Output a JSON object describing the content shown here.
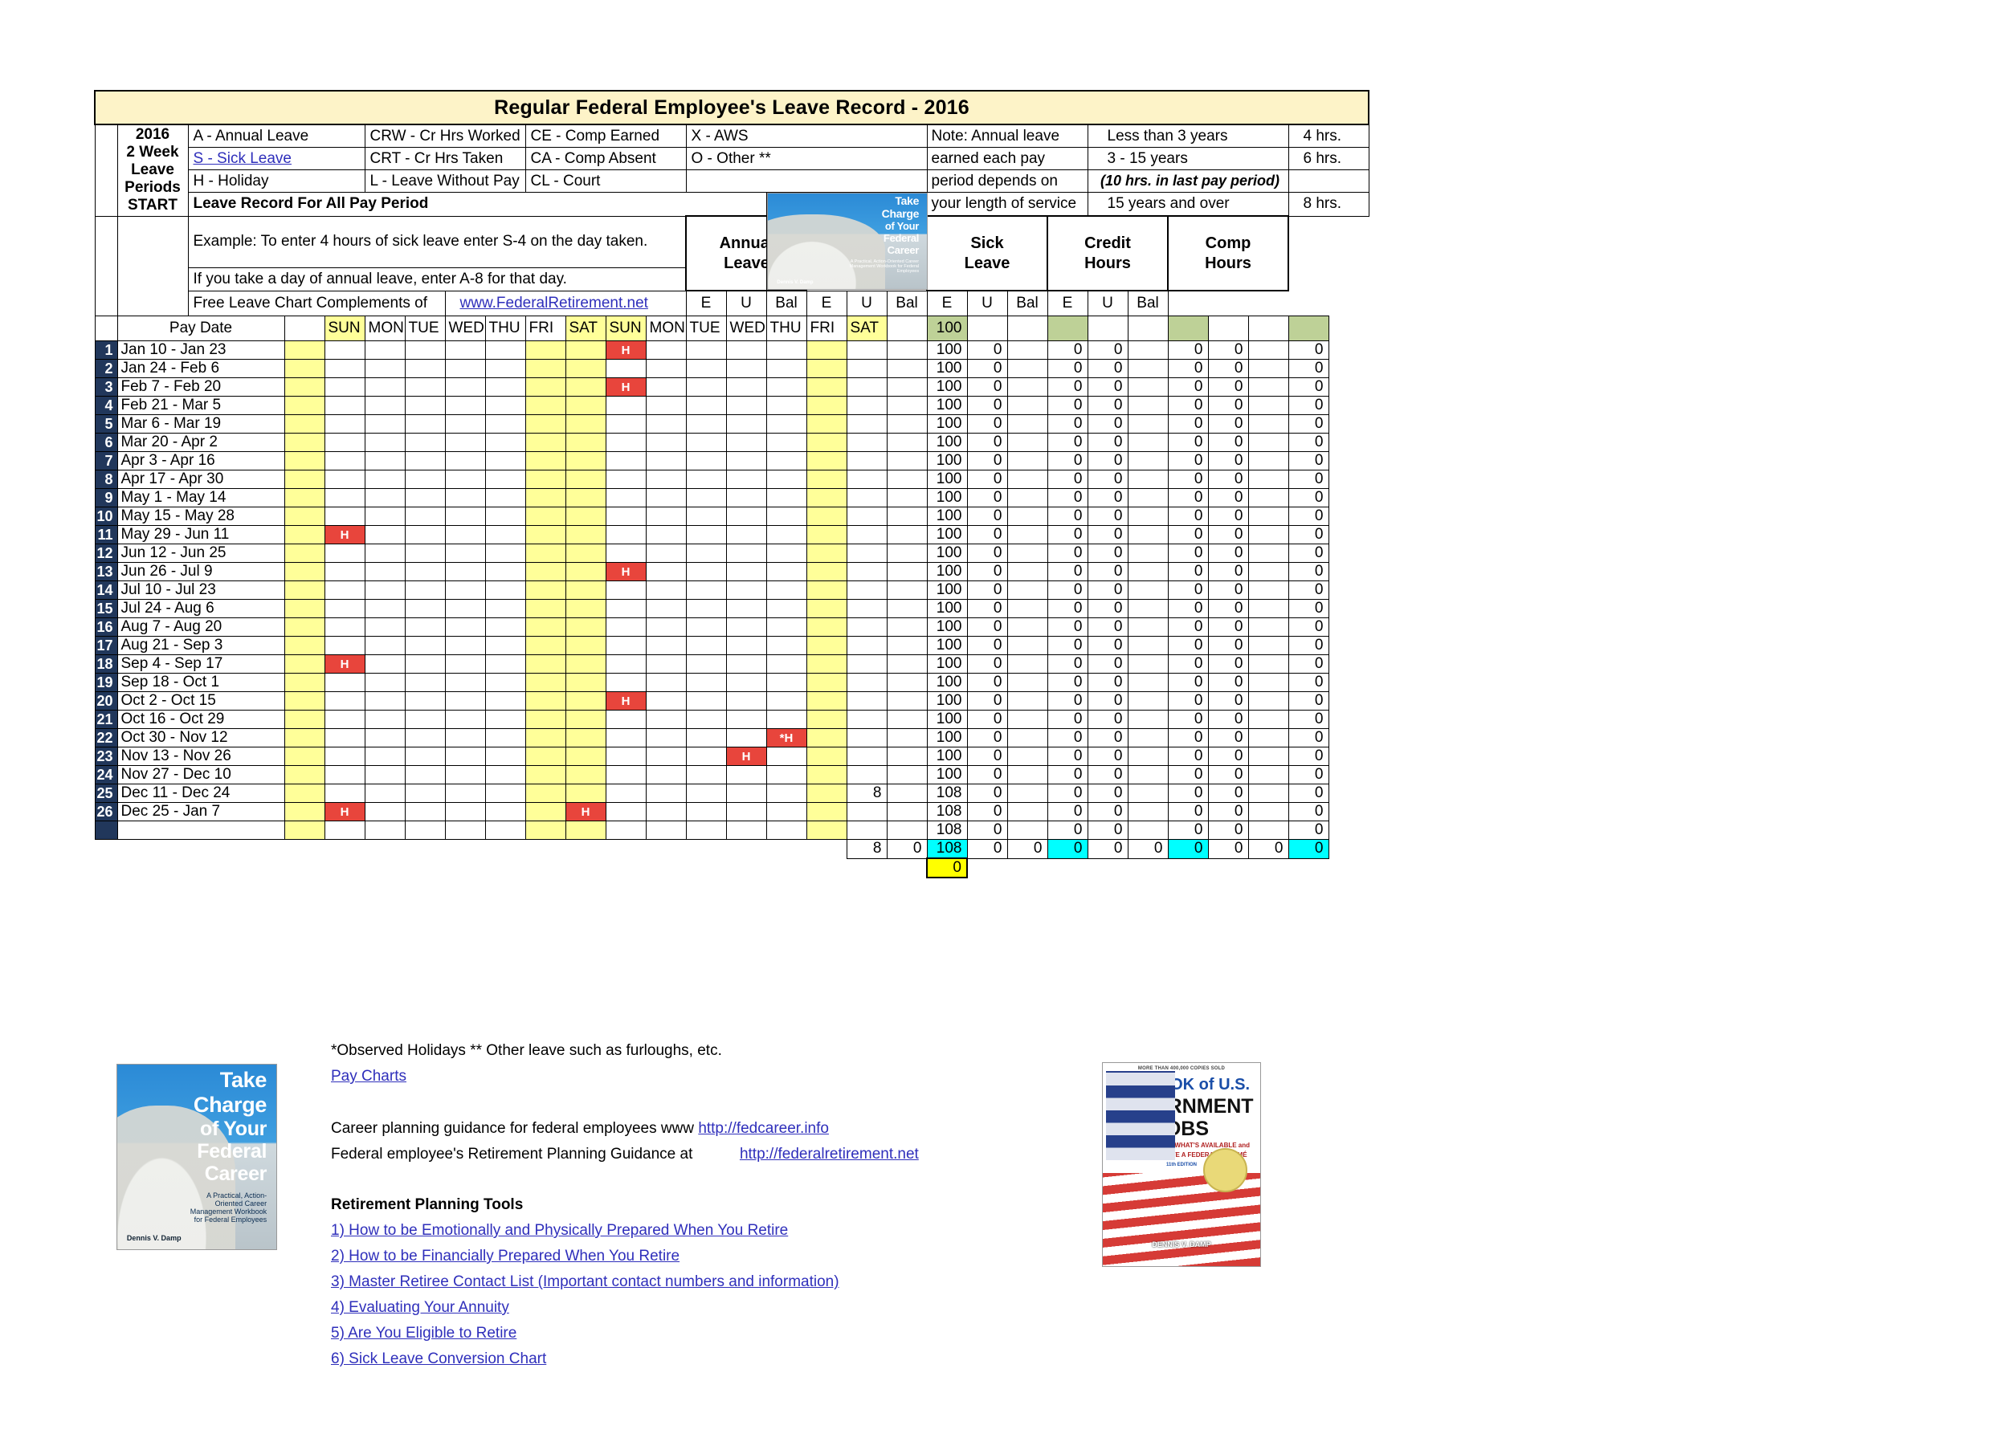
{
  "title": "Regular Federal Employee's Leave Record - 2016",
  "legend": {
    "col1": [
      "A - Annual Leave",
      "S  - Sick Leave",
      "H - Holiday"
    ],
    "col2": [
      "CRW - Cr Hrs Worked",
      "CRT - Cr Hrs Taken",
      "L    - Leave Without Pay"
    ],
    "col3": [
      "CE - Comp Earned",
      "CA - Comp Absent",
      "CL  - Court"
    ],
    "col4": [
      "X - AWS",
      "O - Other **",
      ""
    ],
    "record_header": "Leave Record For All Pay Period",
    "example1": "Example: To enter 4 hours of sick leave enter S-4 on the day taken.",
    "example2": "If you take a day of annual leave, enter A-8 for that day.",
    "complements_label": "Free Leave Chart Complements of",
    "complements_link": "www.FederalRetirement.net"
  },
  "left_labels": [
    "2016",
    "2 Week",
    "Leave Periods",
    "START"
  ],
  "note": {
    "lines": [
      "Note:  Annual leave",
      "earned each pay",
      "period depends on",
      "your length of service"
    ],
    "service": [
      "Less than 3 years",
      "3 - 15 years",
      "(10 hrs. in last pay period)",
      "15 years and over"
    ],
    "hours": [
      "4 hrs.",
      "6 hrs.",
      "",
      "8 hrs."
    ]
  },
  "categories": [
    {
      "l1": "Annual",
      "l2": "Leave"
    },
    {
      "l1": "Sick",
      "l2": "Leave"
    },
    {
      "l1": "Credit",
      "l2": "Hours"
    },
    {
      "l1": "Comp",
      "l2": "Hours"
    }
  ],
  "sub_headers": [
    "E",
    "U",
    "Bal"
  ],
  "pay_date_header": "Pay Date",
  "day_headers": [
    "SUN",
    "MON",
    "TUE",
    "WED",
    "THU",
    "FRI",
    "SAT",
    "SUN",
    "MON",
    "TUE",
    "WED",
    "THU",
    "FRI",
    "SAT"
  ],
  "starting_balance": "100",
  "rows": [
    {
      "n": "1",
      "date": "Jan 10 - Jan 23",
      "holidays": {
        "8": "H"
      },
      "annual": [
        "",
        "",
        "100"
      ],
      "sick": [
        "0",
        "",
        "0"
      ],
      "credit": [
        "0",
        "",
        "0"
      ],
      "comp": [
        "0",
        "",
        "0"
      ]
    },
    {
      "n": "2",
      "date": "Jan 24 - Feb 6",
      "holidays": {},
      "annual": [
        "",
        "",
        "100"
      ],
      "sick": [
        "0",
        "",
        "0"
      ],
      "credit": [
        "0",
        "",
        "0"
      ],
      "comp": [
        "0",
        "",
        "0"
      ]
    },
    {
      "n": "3",
      "date": "Feb 7 - Feb 20",
      "holidays": {
        "8": "H"
      },
      "annual": [
        "",
        "",
        "100"
      ],
      "sick": [
        "0",
        "",
        "0"
      ],
      "credit": [
        "0",
        "",
        "0"
      ],
      "comp": [
        "0",
        "",
        "0"
      ]
    },
    {
      "n": "4",
      "date": "Feb 21 - Mar 5",
      "holidays": {},
      "annual": [
        "",
        "",
        "100"
      ],
      "sick": [
        "0",
        "",
        "0"
      ],
      "credit": [
        "0",
        "",
        "0"
      ],
      "comp": [
        "0",
        "",
        "0"
      ]
    },
    {
      "n": "5",
      "date": "Mar 6 - Mar 19",
      "holidays": {},
      "annual": [
        "",
        "",
        "100"
      ],
      "sick": [
        "0",
        "",
        "0"
      ],
      "credit": [
        "0",
        "",
        "0"
      ],
      "comp": [
        "0",
        "",
        "0"
      ]
    },
    {
      "n": "6",
      "date": "Mar 20 - Apr 2",
      "holidays": {},
      "annual": [
        "",
        "",
        "100"
      ],
      "sick": [
        "0",
        "",
        "0"
      ],
      "credit": [
        "0",
        "",
        "0"
      ],
      "comp": [
        "0",
        "",
        "0"
      ]
    },
    {
      "n": "7",
      "date": "Apr 3 - Apr  16",
      "holidays": {},
      "annual": [
        "",
        "",
        "100"
      ],
      "sick": [
        "0",
        "",
        "0"
      ],
      "credit": [
        "0",
        "",
        "0"
      ],
      "comp": [
        "0",
        "",
        "0"
      ]
    },
    {
      "n": "8",
      "date": "Apr  17 - Apr 30",
      "holidays": {},
      "annual": [
        "",
        "",
        "100"
      ],
      "sick": [
        "0",
        "",
        "0"
      ],
      "credit": [
        "0",
        "",
        "0"
      ],
      "comp": [
        "0",
        "",
        "0"
      ]
    },
    {
      "n": "9",
      "date": "May 1 - May 14",
      "holidays": {},
      "annual": [
        "",
        "",
        "100"
      ],
      "sick": [
        "0",
        "",
        "0"
      ],
      "credit": [
        "0",
        "",
        "0"
      ],
      "comp": [
        "0",
        "",
        "0"
      ]
    },
    {
      "n": "10",
      "date": "May 15 - May 28",
      "holidays": {},
      "annual": [
        "",
        "",
        "100"
      ],
      "sick": [
        "0",
        "",
        "0"
      ],
      "credit": [
        "0",
        "",
        "0"
      ],
      "comp": [
        "0",
        "",
        "0"
      ]
    },
    {
      "n": "11",
      "date": "May 29 - Jun 11",
      "holidays": {
        "1": "H"
      },
      "annual": [
        "",
        "",
        "100"
      ],
      "sick": [
        "0",
        "",
        "0"
      ],
      "credit": [
        "0",
        "",
        "0"
      ],
      "comp": [
        "0",
        "",
        "0"
      ]
    },
    {
      "n": "12",
      "date": "Jun 12 - Jun 25",
      "holidays": {},
      "annual": [
        "",
        "",
        "100"
      ],
      "sick": [
        "0",
        "",
        "0"
      ],
      "credit": [
        "0",
        "",
        "0"
      ],
      "comp": [
        "0",
        "",
        "0"
      ]
    },
    {
      "n": "13",
      "date": "Jun 26 - Jul 9",
      "holidays": {
        "8": "H"
      },
      "annual": [
        "",
        "",
        "100"
      ],
      "sick": [
        "0",
        "",
        "0"
      ],
      "credit": [
        "0",
        "",
        "0"
      ],
      "comp": [
        "0",
        "",
        "0"
      ]
    },
    {
      "n": "14",
      "date": "Jul 10 - Jul 23",
      "holidays": {},
      "annual": [
        "",
        "",
        "100"
      ],
      "sick": [
        "0",
        "",
        "0"
      ],
      "credit": [
        "0",
        "",
        "0"
      ],
      "comp": [
        "0",
        "",
        "0"
      ]
    },
    {
      "n": "15",
      "date": "Jul 24 - Aug 6",
      "holidays": {},
      "annual": [
        "",
        "",
        "100"
      ],
      "sick": [
        "0",
        "",
        "0"
      ],
      "credit": [
        "0",
        "",
        "0"
      ],
      "comp": [
        "0",
        "",
        "0"
      ]
    },
    {
      "n": "16",
      "date": "Aug 7 - Aug 20",
      "holidays": {},
      "annual": [
        "",
        "",
        "100"
      ],
      "sick": [
        "0",
        "",
        "0"
      ],
      "credit": [
        "0",
        "",
        "0"
      ],
      "comp": [
        "0",
        "",
        "0"
      ]
    },
    {
      "n": "17",
      "date": "Aug 21 - Sep 3",
      "holidays": {},
      "annual": [
        "",
        "",
        "100"
      ],
      "sick": [
        "0",
        "",
        "0"
      ],
      "credit": [
        "0",
        "",
        "0"
      ],
      "comp": [
        "0",
        "",
        "0"
      ]
    },
    {
      "n": "18",
      "date": "Sep 4 - Sep  17",
      "holidays": {
        "1": "H"
      },
      "annual": [
        "",
        "",
        "100"
      ],
      "sick": [
        "0",
        "",
        "0"
      ],
      "credit": [
        "0",
        "",
        "0"
      ],
      "comp": [
        "0",
        "",
        "0"
      ]
    },
    {
      "n": "19",
      "date": "Sep  18 - Oct 1",
      "holidays": {},
      "annual": [
        "",
        "",
        "100"
      ],
      "sick": [
        "0",
        "",
        "0"
      ],
      "credit": [
        "0",
        "",
        "0"
      ],
      "comp": [
        "0",
        "",
        "0"
      ]
    },
    {
      "n": "20",
      "date": "Oct 2 - Oct  15",
      "holidays": {
        "8": "H"
      },
      "annual": [
        "",
        "",
        "100"
      ],
      "sick": [
        "0",
        "",
        "0"
      ],
      "credit": [
        "0",
        "",
        "0"
      ],
      "comp": [
        "0",
        "",
        "0"
      ]
    },
    {
      "n": "21",
      "date": "Oct  16 - Oct 29",
      "holidays": {},
      "annual": [
        "",
        "",
        "100"
      ],
      "sick": [
        "0",
        "",
        "0"
      ],
      "credit": [
        "0",
        "",
        "0"
      ],
      "comp": [
        "0",
        "",
        "0"
      ]
    },
    {
      "n": "22",
      "date": "Oct 30 - Nov  12",
      "holidays": {
        "12": "*H"
      },
      "annual": [
        "",
        "",
        "100"
      ],
      "sick": [
        "0",
        "",
        "0"
      ],
      "credit": [
        "0",
        "",
        "0"
      ],
      "comp": [
        "0",
        "",
        "0"
      ]
    },
    {
      "n": "23",
      "date": "Nov  13 - Nov 26",
      "holidays": {
        "11": "H"
      },
      "annual": [
        "",
        "",
        "100"
      ],
      "sick": [
        "0",
        "",
        "0"
      ],
      "credit": [
        "0",
        "",
        "0"
      ],
      "comp": [
        "0",
        "",
        "0"
      ]
    },
    {
      "n": "24",
      "date": "Nov 27 - Dec  10",
      "holidays": {},
      "annual": [
        "",
        "",
        "100"
      ],
      "sick": [
        "0",
        "",
        "0"
      ],
      "credit": [
        "0",
        "",
        "0"
      ],
      "comp": [
        "0",
        "",
        "0"
      ]
    },
    {
      "n": "25",
      "date": "Dec  11 - Dec 24",
      "holidays": {},
      "annual": [
        "8",
        "",
        "108"
      ],
      "sick": [
        "0",
        "",
        "0"
      ],
      "credit": [
        "0",
        "",
        "0"
      ],
      "comp": [
        "0",
        "",
        "0"
      ]
    },
    {
      "n": "26",
      "date": "Dec 25 - Jan 7",
      "holidays": {
        "1": "H",
        "7": "H"
      },
      "annual": [
        "",
        "",
        "108"
      ],
      "sick": [
        "0",
        "",
        "0"
      ],
      "credit": [
        "0",
        "",
        "0"
      ],
      "comp": [
        "0",
        "",
        "0"
      ]
    },
    {
      "n": "",
      "date": "",
      "holidays": {},
      "annual": [
        "",
        "",
        "108"
      ],
      "sick": [
        "0",
        "",
        "0"
      ],
      "credit": [
        "0",
        "",
        "0"
      ],
      "comp": [
        "0",
        "",
        "0"
      ]
    }
  ],
  "totals": {
    "annual": [
      "8",
      "0",
      "108"
    ],
    "sick": [
      "0",
      "0",
      "0"
    ],
    "credit": [
      "0",
      "0",
      "0"
    ],
    "comp": [
      "0",
      "0",
      "0"
    ]
  },
  "carryover": "0",
  "footer": {
    "observed": "*Observed Holidays  ** Other leave such as furloughs, etc.",
    "pay_charts": "Pay Charts",
    "career_text": "Career planning guidance for federal employees www",
    "career_link": "http://fedcareer.info",
    "retirement_text": "Federal employee's Retirement Planning Guidance at",
    "retirement_link": "http://federalretirement.net",
    "tools_header": "Retirement Planning Tools",
    "tools": [
      "1)  How to be Emotionally and Physically Prepared When You Retire",
      "2)  How to be Financially Prepared When You Retire",
      "3)  Master Retiree Contact List (Important contact numbers and information)",
      "4)  Evaluating Your Annuity",
      "5)  Are You Eligible to Retire",
      "6)  Sick Leave Conversion Chart"
    ]
  },
  "book1": {
    "l1": "Take",
    "l2": "Charge",
    "l3": "of Your",
    "l4": "Federal",
    "l5": "Career",
    "sub": "A Practical, Action-Oriented Career Management Workbook for Federal Employees",
    "author": "Dennis V. Damp"
  },
  "book2": {
    "top": "MORE THAN 400,000 COPIES SOLD",
    "l1": "The BOOK of U.S.",
    "l2": "GOVERNMENT",
    "l3": "JOBS",
    "sub1": "WHERE THEY ARE, WHAT'S AVAILABLE and",
    "sub2": "HOW TO COMPLETE A FEDERAL RÉSUMÉ",
    "edition": "11th EDITION",
    "author": "DENNIS V. DAMP"
  },
  "colors": {
    "title_bg": "#fdf3c8",
    "weekend": "#ffff99",
    "holiday": "#e8453c",
    "rownum_bg": "#21375b",
    "bal_green": "#bed197",
    "bal_cyan": "#00ffff",
    "bal_yellow": "#ffff00",
    "link": "#2f2fbb"
  }
}
